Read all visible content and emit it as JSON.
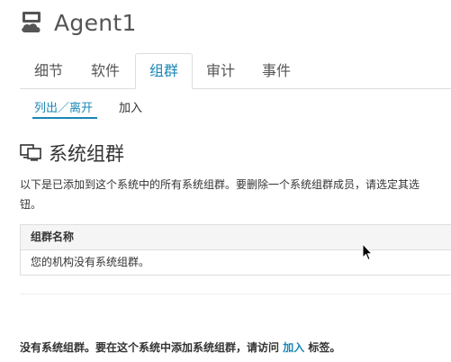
{
  "header": {
    "title": "Agent1",
    "icon": "server-icon"
  },
  "tabs": [
    {
      "label": "细节",
      "active": false
    },
    {
      "label": "软件",
      "active": false
    },
    {
      "label": "组群",
      "active": true
    },
    {
      "label": "审计",
      "active": false
    },
    {
      "label": "事件",
      "active": false
    }
  ],
  "subtabs": [
    {
      "label": "列出／离开",
      "active": true
    },
    {
      "label": "加入",
      "active": false
    }
  ],
  "section": {
    "title": "系统组群",
    "icon": "monitor-icon",
    "description_line1": "以下是已添加到这个系统中的所有系统组群。要删除一个系统组群成员，请选定其选",
    "description_line2": "钮。"
  },
  "table": {
    "header": "组群名称",
    "empty_row": "您的机构没有系统组群。"
  },
  "footer": {
    "text_before": "没有系统组群。要在这个系统中添加系统组群，请访问 ",
    "link": "加入",
    "text_after": " 标签。"
  },
  "colors": {
    "accent": "#1a87b5",
    "text": "#333333",
    "border": "#dddddd"
  }
}
